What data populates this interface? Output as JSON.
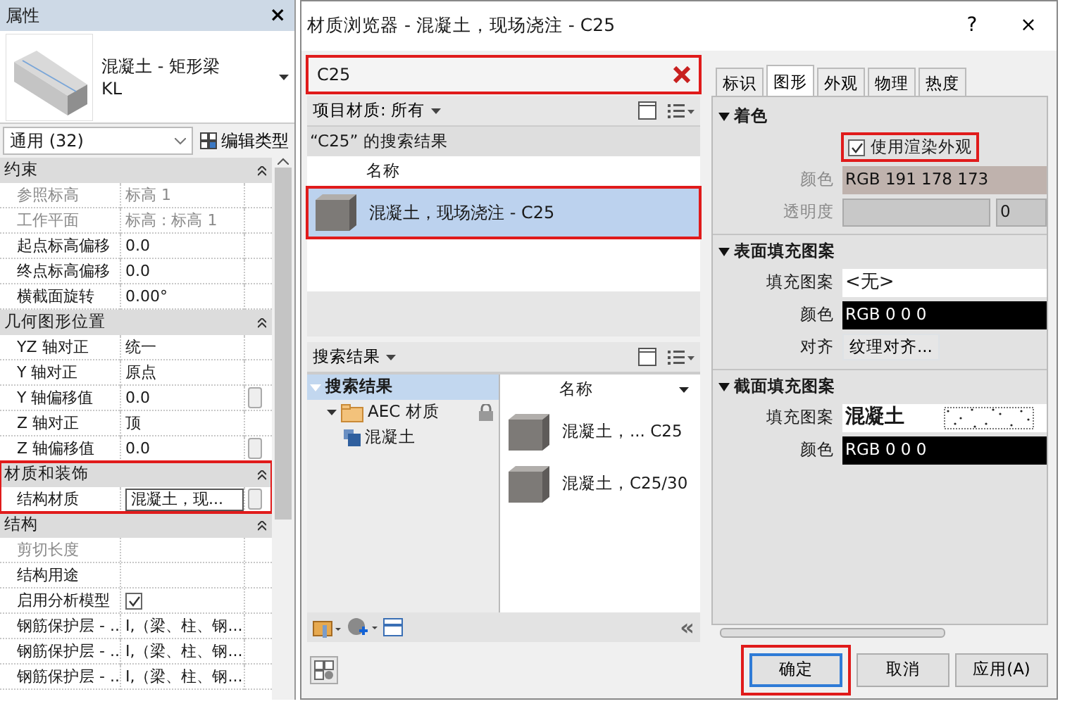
{
  "properties_panel": {
    "title": "属性",
    "close": "×",
    "type_name": "混凝土 - 矩形梁",
    "type_subtype": "KL",
    "filter": "通用 (32)",
    "edit_type_button": "编辑类型",
    "groups": [
      {
        "title": "约束",
        "highlighted": false,
        "rows": [
          {
            "label": "参照标高",
            "value": "标高 1",
            "kind": "text",
            "disabled": true
          },
          {
            "label": "工作平面",
            "value": "标高 : 标高 1",
            "kind": "text",
            "disabled": true
          },
          {
            "label": "起点标高偏移",
            "value": "0.0",
            "kind": "text",
            "disabled": false
          },
          {
            "label": "终点标高偏移",
            "value": "0.0",
            "kind": "text",
            "disabled": false
          },
          {
            "label": "横截面旋转",
            "value": "0.00°",
            "kind": "text",
            "disabled": false
          }
        ]
      },
      {
        "title": "几何图形位置",
        "highlighted": false,
        "rows": [
          {
            "label": "YZ 轴对正",
            "value": "统一",
            "kind": "text",
            "disabled": false
          },
          {
            "label": "Y 轴对正",
            "value": "原点",
            "kind": "text",
            "disabled": false
          },
          {
            "label": "Y 轴偏移值",
            "value": "0.0",
            "kind": "spin",
            "disabled": false
          },
          {
            "label": "Z 轴对正",
            "value": "顶",
            "kind": "text",
            "disabled": false
          },
          {
            "label": "Z 轴偏移值",
            "value": "0.0",
            "kind": "spin",
            "disabled": false
          }
        ]
      },
      {
        "title": "材质和装饰",
        "highlighted": true,
        "rows": [
          {
            "label": "结构材质",
            "value": "混凝土，现...",
            "kind": "field",
            "disabled": false
          }
        ]
      },
      {
        "title": "结构",
        "highlighted": false,
        "rows": [
          {
            "label": "剪切长度",
            "value": "",
            "kind": "text",
            "disabled": true
          },
          {
            "label": "结构用途",
            "value": "",
            "kind": "text",
            "disabled": false
          },
          {
            "label": "启用分析模型",
            "kind": "checkbox",
            "checked": true,
            "disabled": false
          },
          {
            "label": "钢筋保护层 - ...",
            "value": "I,（梁、柱、钢...",
            "kind": "text",
            "disabled": false
          },
          {
            "label": "钢筋保护层 - ...",
            "value": "I,（梁、柱、钢...",
            "kind": "text",
            "disabled": false
          },
          {
            "label": "钢筋保护层 - ...",
            "value": "I,（梁、柱、钢...",
            "kind": "text",
            "disabled": false
          }
        ]
      }
    ]
  },
  "material_browser": {
    "title": "材质浏览器 - 混凝土，现场浇注 - C25",
    "help": "?",
    "close": "×",
    "search": {
      "value": "C25",
      "highlighted": true
    },
    "library_filter": "项目材质: 所有",
    "results_header": "“C25” 的搜索结果",
    "results_column": "名称",
    "results": [
      {
        "name": "混凝土，现场浇注 - C25",
        "selected": true,
        "highlighted": true
      }
    ],
    "lower_filter": "搜索结果",
    "tree": [
      {
        "label": "搜索结果",
        "kind": "root",
        "selected": true,
        "children": [
          {
            "label": "AEC 材质",
            "kind": "folder",
            "selected": false,
            "locked": true,
            "children": [
              {
                "label": "混凝土",
                "kind": "category",
                "selected": false,
                "locked": false
              }
            ]
          }
        ]
      }
    ],
    "list_column": "名称",
    "list_items": [
      {
        "name": "混凝土，... C25"
      },
      {
        "name": "混凝土，C25/30"
      }
    ],
    "collapse": "«",
    "tabs": [
      {
        "label": "标识",
        "selected": false
      },
      {
        "label": "图形",
        "selected": true
      },
      {
        "label": "外观",
        "selected": false
      },
      {
        "label": "物理",
        "selected": false
      },
      {
        "label": "热度",
        "selected": false
      }
    ],
    "sections": [
      {
        "title": "着色",
        "expanded": true,
        "rows": [
          {
            "kind": "checkbox",
            "label": "使用渲染外观",
            "checked": true,
            "highlighted": true
          },
          {
            "kind": "color",
            "label": "颜色",
            "value": "RGB 191 178 173",
            "color": "#bfb2ad",
            "disabled": true
          },
          {
            "kind": "slider",
            "label": "透明度",
            "value": "0",
            "disabled": true
          }
        ]
      },
      {
        "title": "表面填充图案",
        "expanded": true,
        "rows": [
          {
            "kind": "pattern",
            "label": "填充图案",
            "value": "<无>",
            "preview": false
          },
          {
            "kind": "color",
            "label": "颜色",
            "value": "RGB 0 0 0",
            "color": "#000000",
            "disabled": false
          },
          {
            "kind": "button",
            "label": "对齐",
            "value": "纹理对齐..."
          }
        ]
      },
      {
        "title": "截面填充图案",
        "expanded": true,
        "rows": [
          {
            "kind": "pattern",
            "label": "填充图案",
            "value": "混凝土",
            "preview": true
          },
          {
            "kind": "color",
            "label": "颜色",
            "value": "RGB 0 0 0",
            "color": "#000000",
            "disabled": false
          }
        ]
      }
    ],
    "buttons": [
      {
        "label": "确定",
        "default": true,
        "highlighted": true
      },
      {
        "label": "取消",
        "default": false,
        "highlighted": false
      },
      {
        "label": "应用(A)",
        "default": false,
        "highlighted": false
      }
    ]
  }
}
